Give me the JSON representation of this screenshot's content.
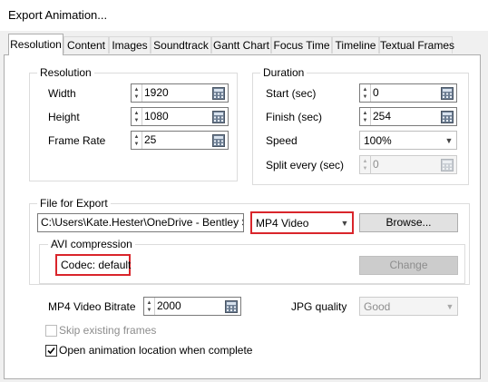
{
  "window": {
    "title": "Export Animation..."
  },
  "tabs": [
    {
      "label": "Resolution",
      "active": true
    },
    {
      "label": "Content",
      "active": false
    },
    {
      "label": "Images",
      "active": false
    },
    {
      "label": "Soundtrack",
      "active": false
    },
    {
      "label": "Gantt Chart",
      "active": false
    },
    {
      "label": "Focus Time",
      "active": false
    },
    {
      "label": "Timeline",
      "active": false
    },
    {
      "label": "Textual Frames",
      "active": false
    }
  ],
  "resolution": {
    "group_title": "Resolution",
    "width_label": "Width",
    "width_value": "1920",
    "height_label": "Height",
    "height_value": "1080",
    "framerate_label": "Frame Rate",
    "framerate_value": "25"
  },
  "duration": {
    "group_title": "Duration",
    "start_label": "Start (sec)",
    "start_value": "0",
    "finish_label": "Finish (sec)",
    "finish_value": "254",
    "speed_label": "Speed",
    "speed_value": "100%",
    "split_label": "Split every (sec)",
    "split_value": "0"
  },
  "file_export": {
    "group_title": "File for Export",
    "path": "C:\\Users\\Kate.Hester\\OneDrive - Bentley Syste",
    "format": "MP4 Video",
    "browse_label": "Browse...",
    "avi_group_title": "AVI compression",
    "codec_text": "Codec: default",
    "change_label": "Change"
  },
  "bitrate": {
    "label": "MP4 Video Bitrate",
    "value": "2000"
  },
  "jpg": {
    "label": "JPG quality",
    "value": "Good"
  },
  "options": {
    "skip_label": "Skip existing frames",
    "skip_checked": false,
    "skip_enabled": false,
    "open_label": "Open animation location when complete",
    "open_checked": true
  },
  "colors": {
    "highlight_border": "#d9252b",
    "panel_bg": "#ffffff",
    "window_bg": "#f0f0f0"
  },
  "icons": {
    "calculator": "calculator-icon",
    "spin": "spin-arrows-icon",
    "dropdown": "chevron-down-icon",
    "check": "checkmark-icon"
  }
}
